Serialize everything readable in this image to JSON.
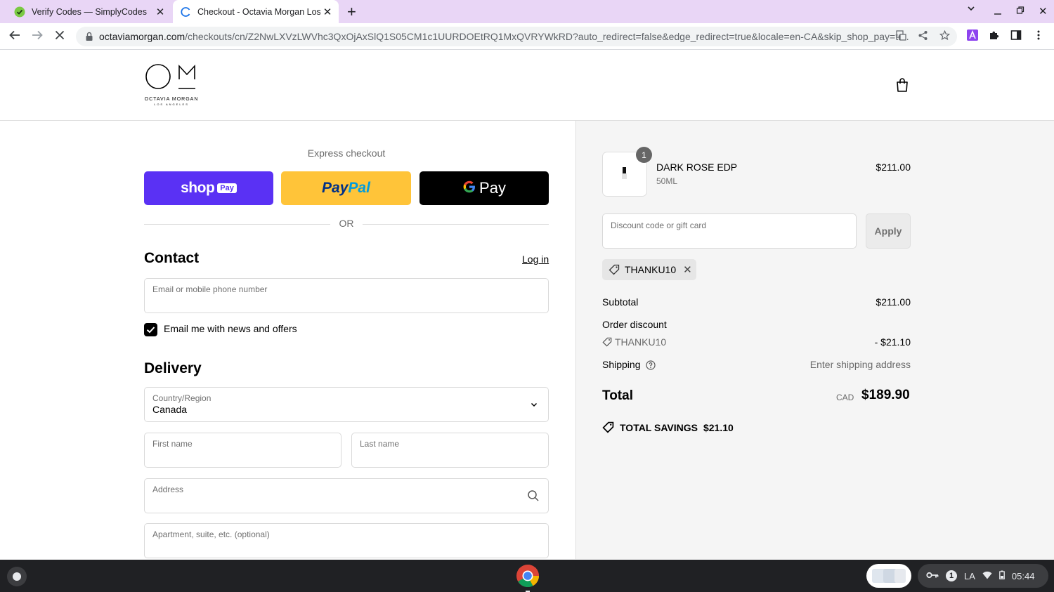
{
  "browser": {
    "tabs": [
      {
        "title": "Verify Codes — SimplyCodes",
        "active": false
      },
      {
        "title": "Checkout - Octavia Morgan Los Angeles",
        "active": true
      }
    ],
    "url_host": "octaviamorgan.com",
    "url_path": "/checkouts/cn/Z2NwLXVzLWVhc3QxOjAxSlQ1S05CM1c1UURDOEtRQ1MxQVRYWkRD?auto_redirect=false&edge_redirect=true&locale=en-CA&skip_shop_pay=tr..."
  },
  "brand": {
    "logo_text": "OCTAVIA MORGAN",
    "logo_sub": "LOS ANGELES",
    "shop_pay_color": "#5a31f4",
    "paypal_color": "#ffc439"
  },
  "express": {
    "title": "Express checkout",
    "shop_label": "shop",
    "shop_pay_tag": "Pay",
    "paypal_pay": "Pay",
    "paypal_pal": "Pal",
    "gpay_label": "Pay",
    "or": "OR"
  },
  "contact": {
    "heading": "Contact",
    "login": "Log in",
    "email_placeholder": "Email or mobile phone number",
    "news_label": "Email me with news and offers",
    "news_checked": true
  },
  "delivery": {
    "heading": "Delivery",
    "country_label": "Country/Region",
    "country_value": "Canada",
    "first_name_label": "First name",
    "last_name_label": "Last name",
    "address_label": "Address",
    "apartment_label": "Apartment, suite, etc. (optional)"
  },
  "summary": {
    "product": {
      "qty": "1",
      "name": "DARK ROSE EDP",
      "variant": "50ML",
      "price": "$211.00"
    },
    "discount_placeholder": "Discount code or gift card",
    "apply": "Apply",
    "applied_code": "THANKU10",
    "subtotal_label": "Subtotal",
    "subtotal_value": "$211.00",
    "order_discount_label": "Order discount",
    "discount_code": "THANKU10",
    "discount_value": "- $21.10",
    "shipping_label": "Shipping",
    "shipping_value": "Enter shipping address",
    "total_label": "Total",
    "total_currency": "CAD",
    "total_value": "$189.90",
    "savings_label": "TOTAL SAVINGS",
    "savings_value": "$21.10"
  },
  "shelf": {
    "notif_count": "1",
    "locale": "LA",
    "time": "05:44"
  }
}
